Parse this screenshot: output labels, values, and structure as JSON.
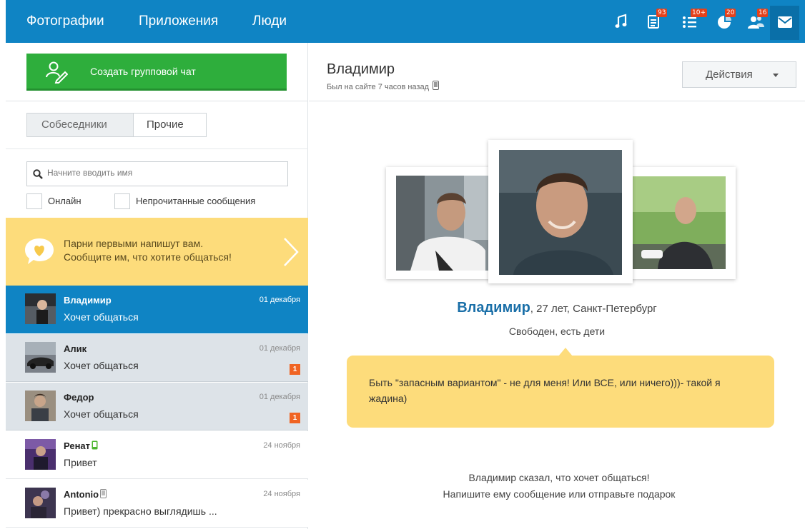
{
  "nav": {
    "items": [
      "Фотографии",
      "Приложения",
      "Люди"
    ],
    "badges": {
      "feed": "93",
      "events": "10+",
      "discussions": "20",
      "guests": "16"
    }
  },
  "sidebar": {
    "create_chat_label": "Создать групповой чат",
    "tabs": [
      "Собеседники",
      "Прочие"
    ],
    "search_placeholder": "Начните вводить имя",
    "filters": [
      "Онлайн",
      "Непрочитанные сообщения"
    ],
    "promo": {
      "line1": "Парни первыми напишут вам.",
      "line2": "Сообщите им, что хотите общаться!"
    },
    "conversations": [
      {
        "name": "Владимир",
        "status": "Хочет общаться",
        "date": "01 декабря",
        "unread": "",
        "device": ""
      },
      {
        "name": "Алик",
        "status": "Хочет общаться",
        "date": "01 декабря",
        "unread": "1",
        "device": ""
      },
      {
        "name": "Федор",
        "status": "Хочет общаться",
        "date": "01 декабря",
        "unread": "1",
        "device": ""
      },
      {
        "name": "Ренат",
        "status": "Привет",
        "date": "24 ноября",
        "unread": "",
        "device": "mobile-green"
      },
      {
        "name": "Antonio",
        "status": "Привет) прекрасно выглядишь ...",
        "date": "24 ноября",
        "unread": "",
        "device": "mobile-gray"
      }
    ]
  },
  "chat": {
    "name": "Владимир",
    "last_seen": "Был на сайте 7 часов назад",
    "actions_label": "Действия",
    "profile_name": "Владимир",
    "profile_details": ", 27 лет, Санкт-Петербург",
    "status": "Свободен, есть дети",
    "quote": "Быть \"запасным вариантом\" - не для меня! Или ВСЕ, или ничего)))- такой я жадина)",
    "notice_line1": "Владимир сказал, что хочет общаться!",
    "notice_line2": "Напишите ему сообщение или отправьте подарок"
  },
  "colors": {
    "topbar": "#0f84c4",
    "create_button": "#2eae3c",
    "promo": "#fddc7b",
    "active_row": "#0f84c4",
    "badge": "#e4411b"
  }
}
